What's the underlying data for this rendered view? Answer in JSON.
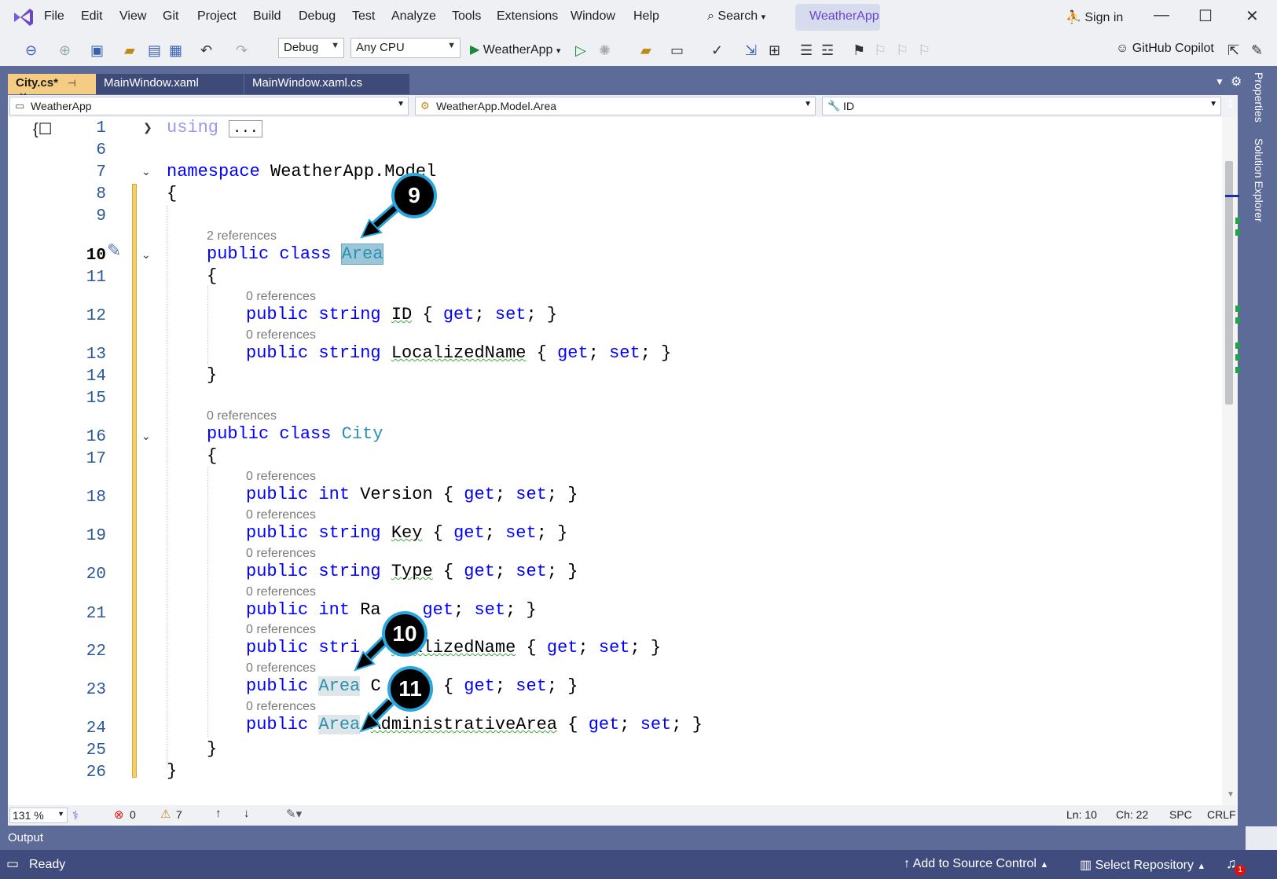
{
  "menu": {
    "items": [
      "File",
      "Edit",
      "View",
      "Git",
      "Project",
      "Build",
      "Debug",
      "Test",
      "Analyze",
      "Tools",
      "Extensions",
      "Window",
      "Help"
    ],
    "search": "Search",
    "solution": "WeatherApp",
    "sign_in": "Sign in"
  },
  "toolbar": {
    "config": "Debug",
    "platform": "Any CPU",
    "run_target": "WeatherApp",
    "copilot": "GitHub Copilot"
  },
  "tabs": [
    {
      "label": "City.cs*",
      "active": true
    },
    {
      "label": "MainWindow.xaml",
      "active": false
    },
    {
      "label": "MainWindow.xaml.cs",
      "active": false
    }
  ],
  "navbar": {
    "project": "WeatherApp",
    "type": "WeatherApp.Model.Area",
    "member": "ID"
  },
  "side_panels": [
    "Properties",
    "Solution Explorer"
  ],
  "code": {
    "line_numbers": [
      "1",
      "6",
      "7",
      "8",
      "9",
      "10",
      "11",
      "12",
      "13",
      "14",
      "15",
      "16",
      "17",
      "18",
      "19",
      "20",
      "21",
      "22",
      "23",
      "24",
      "25",
      "26"
    ],
    "using_kw": "using",
    "using_collapsed": "...",
    "ns_kw": "namespace",
    "ns_name": "WeatherApp.Model",
    "open_brace": "{",
    "close_brace": "}",
    "refs_2": "2 references",
    "refs_0": "0 references",
    "public": "public",
    "class": "class",
    "string": "string",
    "int": "int",
    "get": "get",
    "set": "set",
    "area_class": "Area",
    "city_class": "City",
    "props": {
      "id": "ID",
      "localized": "LocalizedName",
      "version": "Version",
      "key": "Key",
      "type": "Type",
      "rank": "Ra",
      "country_partial": "C",
      "country_tail": "ry",
      "admin": "AdministrativeArea",
      "str_partial": "stri",
      "loc_tail": "ocalizedName"
    }
  },
  "callouts": [
    "9",
    "10",
    "11"
  ],
  "editor_status": {
    "zoom": "131 %",
    "errors": "0",
    "warnings": "7",
    "line": "Ln: 10",
    "col": "Ch: 22",
    "spc": "SPC",
    "eol": "CRLF"
  },
  "output_label": "Output",
  "status": {
    "ready": "Ready",
    "add_source": "Add to Source Control",
    "select_repo": "Select Repository",
    "notif_count": "1"
  },
  "colors": {
    "accent": "#5d6b99",
    "keyword": "#0000ff",
    "type": "#2b91af",
    "callout_ring": "#2aa6df"
  }
}
